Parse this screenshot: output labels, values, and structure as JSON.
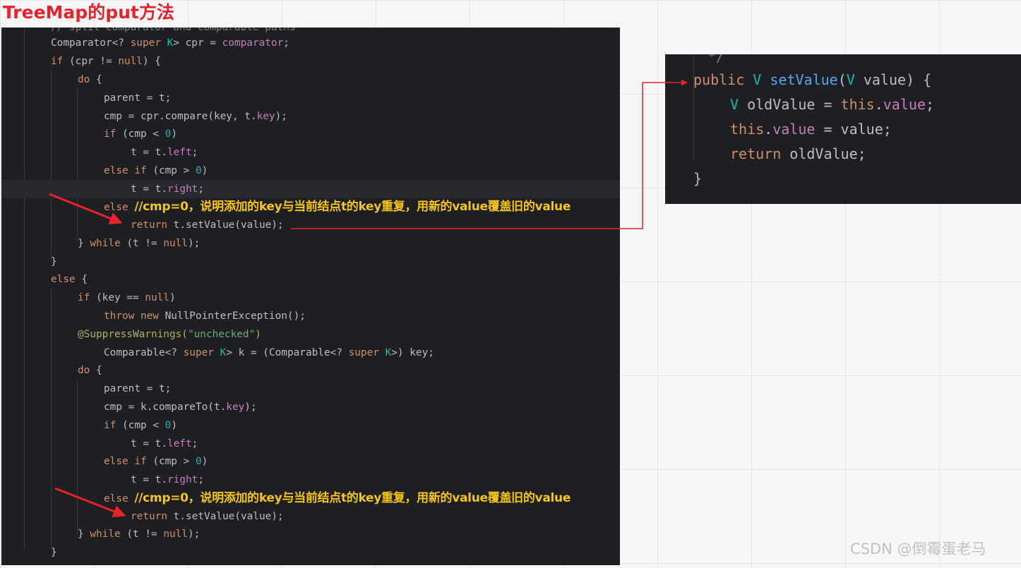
{
  "title": "TreeMap的put方法",
  "left_code": {
    "line0": "// split comparator and comparable paths",
    "line1": [
      "Comparator<? ",
      "super",
      " ",
      "K",
      "> cpr = ",
      "comparator",
      ";"
    ],
    "line2": [
      "if",
      " (cpr != ",
      "null",
      ") {"
    ],
    "line3": [
      "do",
      " {"
    ],
    "line4": "parent = t;",
    "line5": "cmp = cpr.compare(key, t.",
    "line5_field": "key",
    "line5_end": ");",
    "line6": [
      "if",
      " (cmp < ",
      "0",
      ")"
    ],
    "line7": [
      "t = t.",
      "left",
      ";"
    ],
    "line8": [
      "else if",
      " (cmp > ",
      "0",
      ")"
    ],
    "line9": [
      "t = t.",
      "right",
      ";"
    ],
    "line10_kw": "else",
    "line10_note": "//cmp=0，说明添加的key与当前结点t的key重复，用新的value覆盖旧的value",
    "line11": [
      "return",
      " t.setValue(value);"
    ],
    "line12": [
      "} ",
      "while",
      " (t != ",
      "null",
      ");"
    ],
    "line13": "}",
    "line14": [
      "else",
      " {"
    ],
    "line15": [
      "if",
      " (key == ",
      "null",
      ")"
    ],
    "line16": [
      "throw new",
      " NullPointerException();"
    ],
    "line17": [
      "@SuppressWarnings(",
      "\"unchecked\"",
      ")"
    ],
    "line18": [
      "Comparable<? ",
      "super",
      " ",
      "K",
      "> k = (Comparable<? ",
      "super",
      " ",
      "K",
      ">) key;"
    ],
    "line19": [
      "do",
      " {"
    ],
    "line20": "parent = t;",
    "line21": [
      "cmp = k.compareTo(t.",
      "key",
      ");"
    ],
    "line22": [
      "if",
      " (cmp < ",
      "0",
      ")"
    ],
    "line23": [
      "t = t.",
      "left",
      ";"
    ],
    "line24": [
      "else if",
      " (cmp > ",
      "0",
      ")"
    ],
    "line25": [
      "t = t.",
      "right",
      ";"
    ],
    "line26_kw": "else",
    "line26_note": "//cmp=0，说明添加的key与当前结点t的key重复，用新的value覆盖旧的value",
    "line27": [
      "return",
      " t.setValue(value);"
    ],
    "line28": [
      "} ",
      "while",
      " (t != ",
      "null",
      ");"
    ],
    "line29": "}"
  },
  "right_code": {
    "line0": "*/",
    "line1": [
      "public",
      " ",
      "V",
      " ",
      "setValue",
      "(",
      "V",
      " value) {"
    ],
    "line2": [
      "V",
      " oldValue = ",
      "this",
      ".",
      "value",
      ";"
    ],
    "line3": [
      "this",
      ".",
      "value",
      " = value;"
    ],
    "line4": [
      "return",
      " oldValue;"
    ],
    "line5": "}"
  },
  "watermark": "CSDN @倒霉蛋老马",
  "colors": {
    "title": "#e8222b",
    "note": "#f5c518",
    "arrow": "#e8222b",
    "editor_bg": "#1e1f22"
  }
}
